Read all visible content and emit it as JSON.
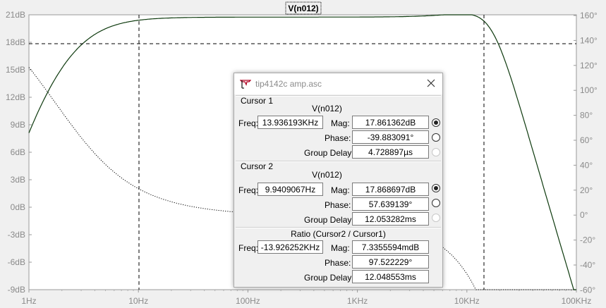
{
  "plot": {
    "trace_title": "V(n012)",
    "y_left_ticks": [
      "21dB",
      "18dB",
      "15dB",
      "12dB",
      "9dB",
      "6dB",
      "3dB",
      "0dB",
      "-3dB",
      "-6dB",
      "-9dB"
    ],
    "y_right_ticks": [
      "160°",
      "140°",
      "120°",
      "100°",
      "80°",
      "60°",
      "40°",
      "20°",
      "0°",
      "-20°",
      "-40°",
      "-60°"
    ],
    "x_ticks": [
      "1Hz",
      "10Hz",
      "100Hz",
      "1KHz",
      "10KHz",
      "100KHz"
    ],
    "colors": {
      "magnitude": "#0e3a0e",
      "phase": "#000000",
      "cursor": "#000000",
      "grid": "#d0d0d0"
    }
  },
  "dialog": {
    "title": "tip4142c amp.asc",
    "cursor1": {
      "header": "Cursor 1",
      "trace": "V(n012)",
      "freq_label": "Freq:",
      "freq": "13.936193KHz",
      "mag_label": "Mag:",
      "mag": "17.861362dB",
      "phase_label": "Phase:",
      "phase": "-39.883091°",
      "gd_label": "Group Delay:",
      "gd": "4.728897µs"
    },
    "cursor2": {
      "header": "Cursor 2",
      "trace": "V(n012)",
      "freq_label": "Freq:",
      "freq": "9.9409067Hz",
      "mag_label": "Mag:",
      "mag": "17.868697dB",
      "phase_label": "Phase:",
      "phase": "57.639139°",
      "gd_label": "Group Delay:",
      "gd": "12.053282ms"
    },
    "ratio": {
      "header": "Ratio (Cursor2 / Cursor1)",
      "freq_label": "Freq:",
      "freq": "-13.926252KHz",
      "mag_label": "Mag:",
      "mag": "7.3355594mdB",
      "phase_label": "Phase:",
      "phase": "97.522229°",
      "gd_label": "Group Delay:",
      "gd": "12.048553ms"
    }
  }
}
